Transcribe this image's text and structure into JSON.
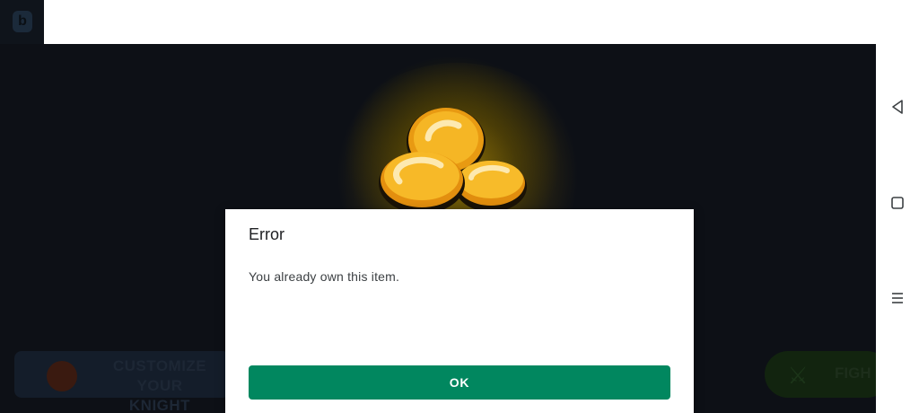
{
  "dialog": {
    "title": "Error",
    "message": "You already own this item.",
    "ok_label": "OK",
    "ok_color": "#01875f"
  },
  "game": {
    "bottom_left_button": {
      "label": "CUSTOMIZE YOUR KNIGHT",
      "line1": "CUSTOMIZE YOUR",
      "line2": "KNIGHT"
    },
    "bottom_right_button": {
      "label": "FIGH"
    },
    "top_left_icon": "b",
    "background_color": "#0d1118",
    "coin_color": "#f5b625"
  },
  "navbar": {
    "icons": [
      "back-icon",
      "home-icon",
      "recents-icon"
    ]
  }
}
